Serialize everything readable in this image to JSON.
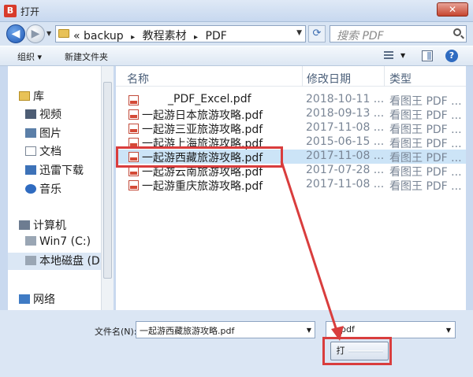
{
  "window": {
    "title": "打开",
    "app_icon": "B",
    "close_glyph": "✕"
  },
  "address": {
    "breadcrumbs": [
      "backup",
      "教程素材",
      "PDF"
    ],
    "prefix": "«",
    "separator": "▸",
    "search_placeholder": "搜索 PDF"
  },
  "toolbar": {
    "organize": "组织 ▾",
    "new_folder": "新建文件夹",
    "help": "?"
  },
  "nav": {
    "libraries": "库",
    "videos": "视频",
    "pictures": "图片",
    "documents": "文档",
    "thunder": "迅雷下载",
    "music": "音乐",
    "computer": "计算机",
    "drive_c": "Win7 (C:)",
    "drive_d": "本地磁盘 (D:",
    "network": "网络"
  },
  "columns": {
    "name": "名称",
    "modified": "修改日期",
    "type": "类型"
  },
  "files": [
    {
      "name": "_PDF_Excel.pdf",
      "date": "2018-10-11 ...",
      "type": "看图王 PDF ..."
    },
    {
      "name": "一起游日本旅游攻略.pdf",
      "date": "2018-09-13 ...",
      "type": "看图王 PDF ..."
    },
    {
      "name": "一起游三亚旅游攻略.pdf",
      "date": "2017-11-08 ...",
      "type": "看图王 PDF ..."
    },
    {
      "name": "一起游上海旅游攻略.pdf",
      "date": "2015-06-15 ...",
      "type": "看图王 PDF ..."
    },
    {
      "name": "一起游西藏旅游攻略.pdf",
      "date": "2017-11-08 ...",
      "type": "看图王 PDF ..."
    },
    {
      "name": "一起游云南旅游攻略.pdf",
      "date": "2017-07-28 ...",
      "type": "看图王 PDF ..."
    },
    {
      "name": "一起游重庆旅游攻略.pdf",
      "date": "2017-11-08 ...",
      "type": "看图王 PDF ..."
    }
  ],
  "footer": {
    "filename_label": "文件名(N):",
    "filename_value": "一起游西藏旅游攻略.pdf",
    "filetype_value": "pdf",
    "open_label": "打"
  },
  "colors": {
    "highlight": "#d93d3d",
    "selection": "#cce4f7"
  }
}
